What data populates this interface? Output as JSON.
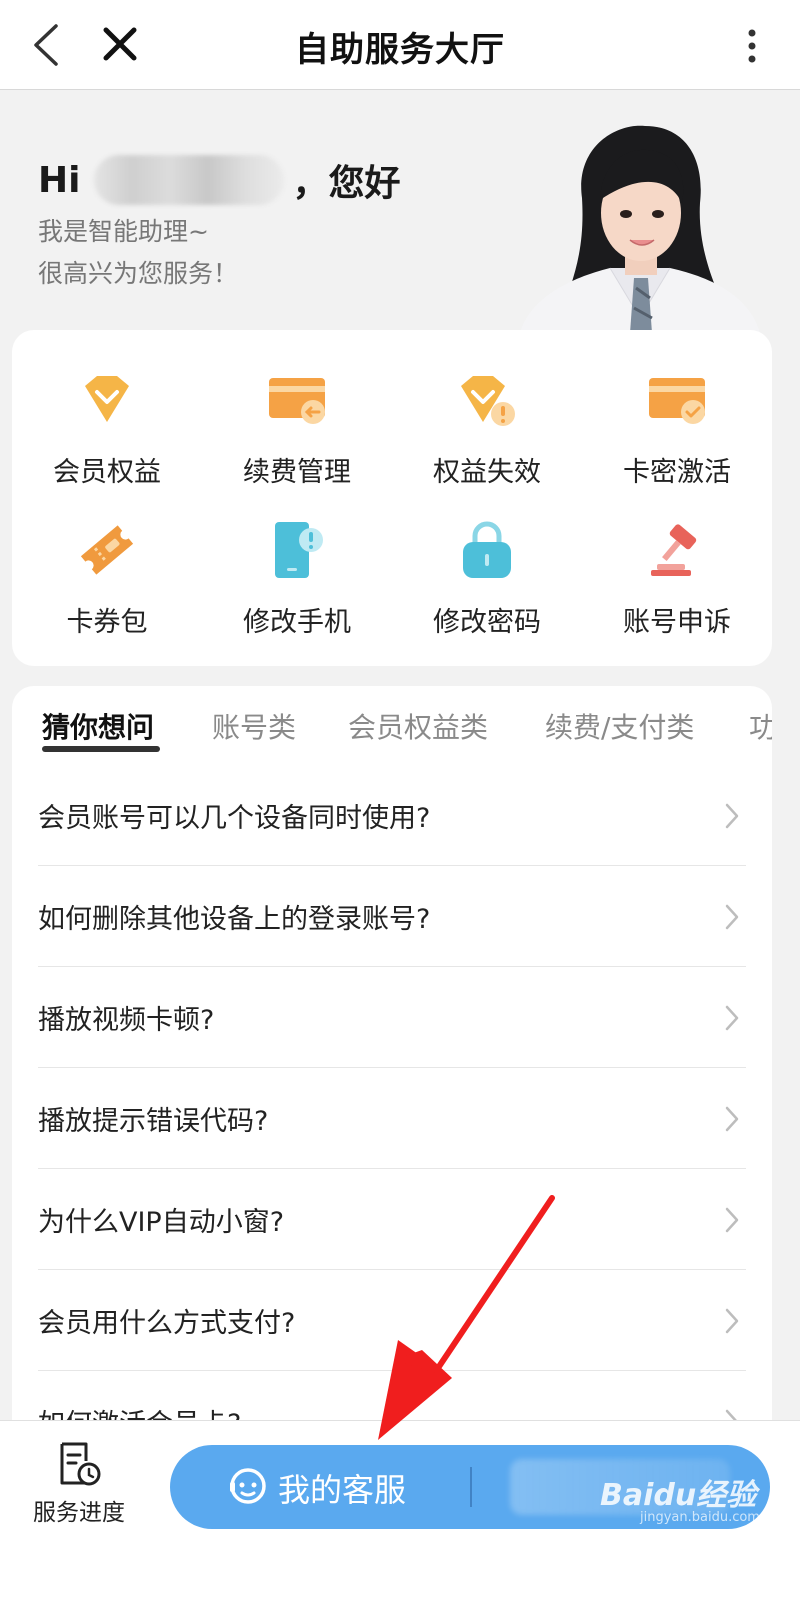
{
  "header": {
    "title": "自助服务大厅",
    "back_icon": "back-arrow-icon",
    "close_icon": "close-icon",
    "more_icon": "more-vertical-icon"
  },
  "greeting": {
    "hi": "Hi",
    "suffix": "，您好",
    "line1": "我是智能助理~",
    "line2": "很高兴为您服务！"
  },
  "services": [
    {
      "label": "会员权益",
      "icon": "diamond-icon"
    },
    {
      "label": "续费管理",
      "icon": "card-arrow-icon"
    },
    {
      "label": "权益失效",
      "icon": "diamond-warning-icon"
    },
    {
      "label": "卡密激活",
      "icon": "card-check-icon"
    },
    {
      "label": "卡券包",
      "icon": "ticket-icon"
    },
    {
      "label": "修改手机",
      "icon": "phone-warning-icon"
    },
    {
      "label": "修改密码",
      "icon": "lock-icon"
    },
    {
      "label": "账号申诉",
      "icon": "gavel-icon"
    }
  ],
  "faq": {
    "tabs": [
      "猜你想问",
      "账号类",
      "会员权益类",
      "续费/支付类",
      "功"
    ],
    "active_tab": 0,
    "questions": [
      "会员账号可以几个设备同时使用?",
      "如何删除其他设备上的登录账号?",
      "播放视频卡顿?",
      "播放提示错误代码?",
      "为什么VIP自动小窗?",
      "会员用什么方式支付?",
      "如何激活会员卡?"
    ]
  },
  "bottom": {
    "progress_label": "服务进度",
    "service_label": "我的客服"
  },
  "watermark": {
    "main": "Baidu经验",
    "sub": "jingyan.baidu.com"
  },
  "colors": {
    "accent_blue": "#5aa9ef",
    "icon_orange": "#f5a623",
    "icon_teal": "#4dbfd9",
    "icon_red": "#e8635a",
    "annotation_red": "#f01e1e"
  }
}
